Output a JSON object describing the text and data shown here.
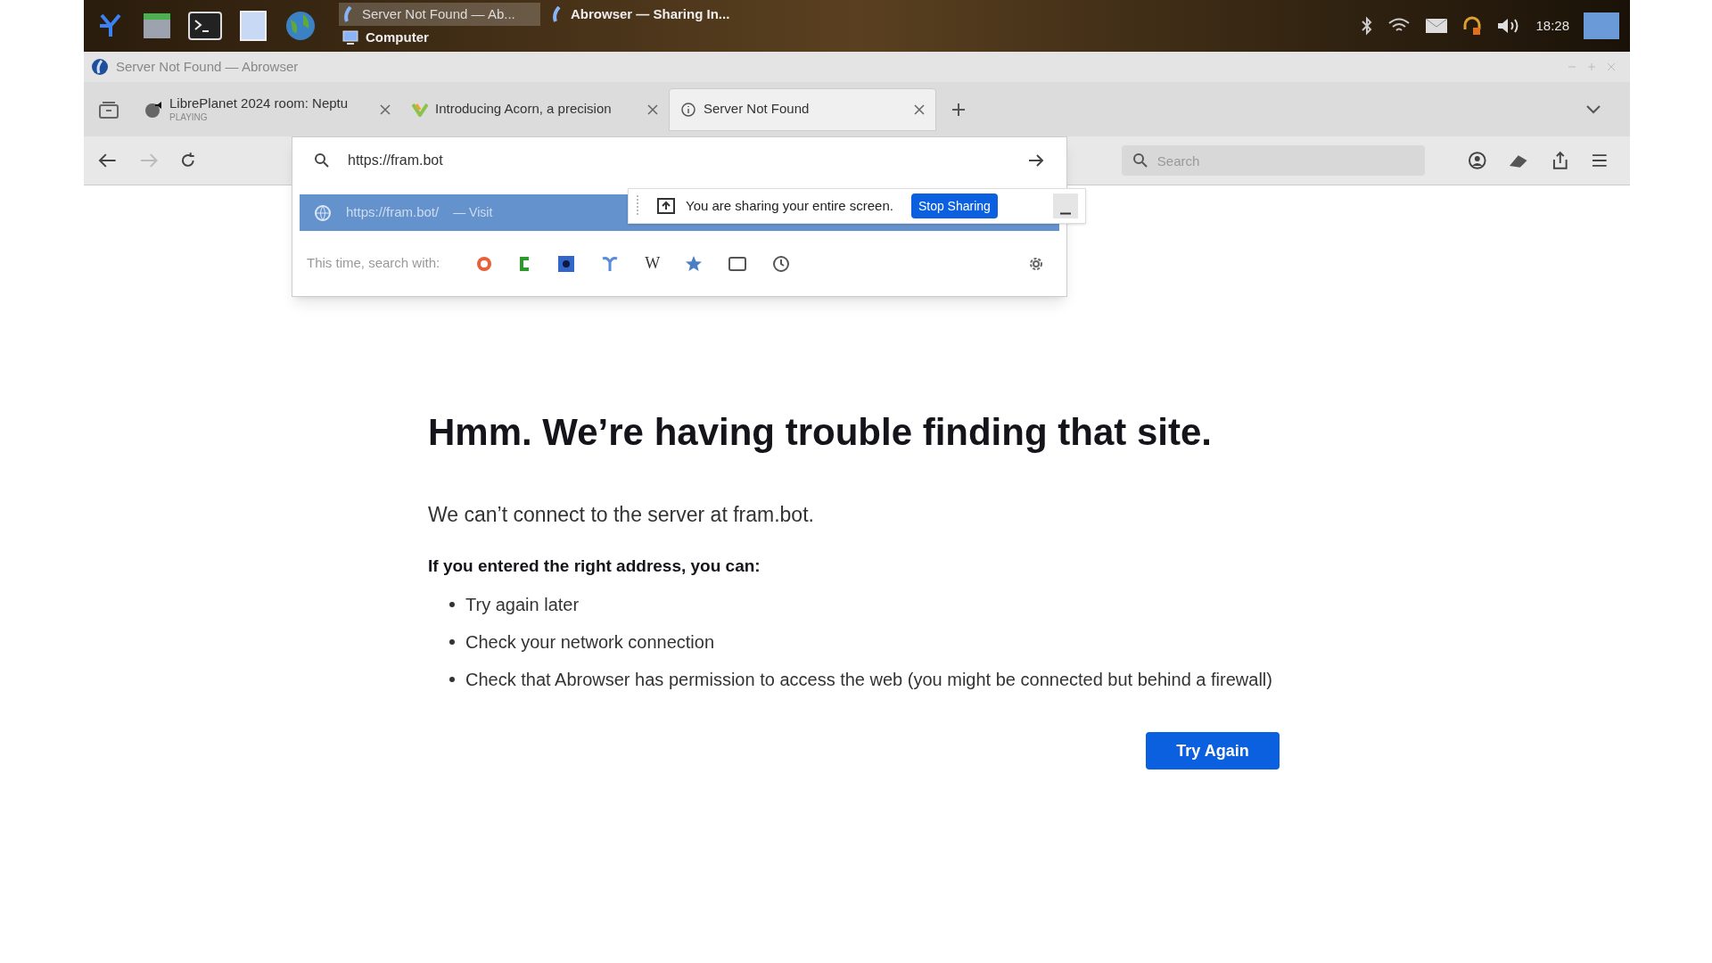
{
  "taskbar": {
    "tasks": [
      {
        "label": "Server Not Found — Ab...",
        "selected": true
      },
      {
        "label": "Abrowser — Sharing In...",
        "selected": false
      },
      {
        "label": "Computer",
        "selected": false
      }
    ],
    "time": "18:28"
  },
  "window": {
    "title": "Server Not Found — Abrowser"
  },
  "tabs": [
    {
      "title": "LibrePlanet 2024 room: Neptu",
      "subtitle": "PLAYING",
      "selected": false
    },
    {
      "title": "Introducing Acorn, a precision",
      "selected": false
    },
    {
      "title": "Server Not Found",
      "selected": true
    }
  ],
  "toolbar": {
    "url": "https://fram.bot",
    "search_placeholder": "Search"
  },
  "url_dropdown": {
    "suggestion": "https://fram.bot/",
    "action": "— Visit",
    "search_with": "This time, search with:",
    "wiki_label": "W"
  },
  "sharing_bar": {
    "message": "You are sharing your entire screen.",
    "button": "Stop Sharing"
  },
  "error": {
    "heading": "Hmm. We’re having trouble finding that site.",
    "message": "We can’t connect to the server at fram.bot.",
    "subheading": "If you entered the right address, you can:",
    "items": [
      "Try again later",
      "Check your network connection",
      "Check that Abrowser has permission to access the web (you might be connected but behind a firewall)"
    ],
    "button": "Try Again"
  }
}
